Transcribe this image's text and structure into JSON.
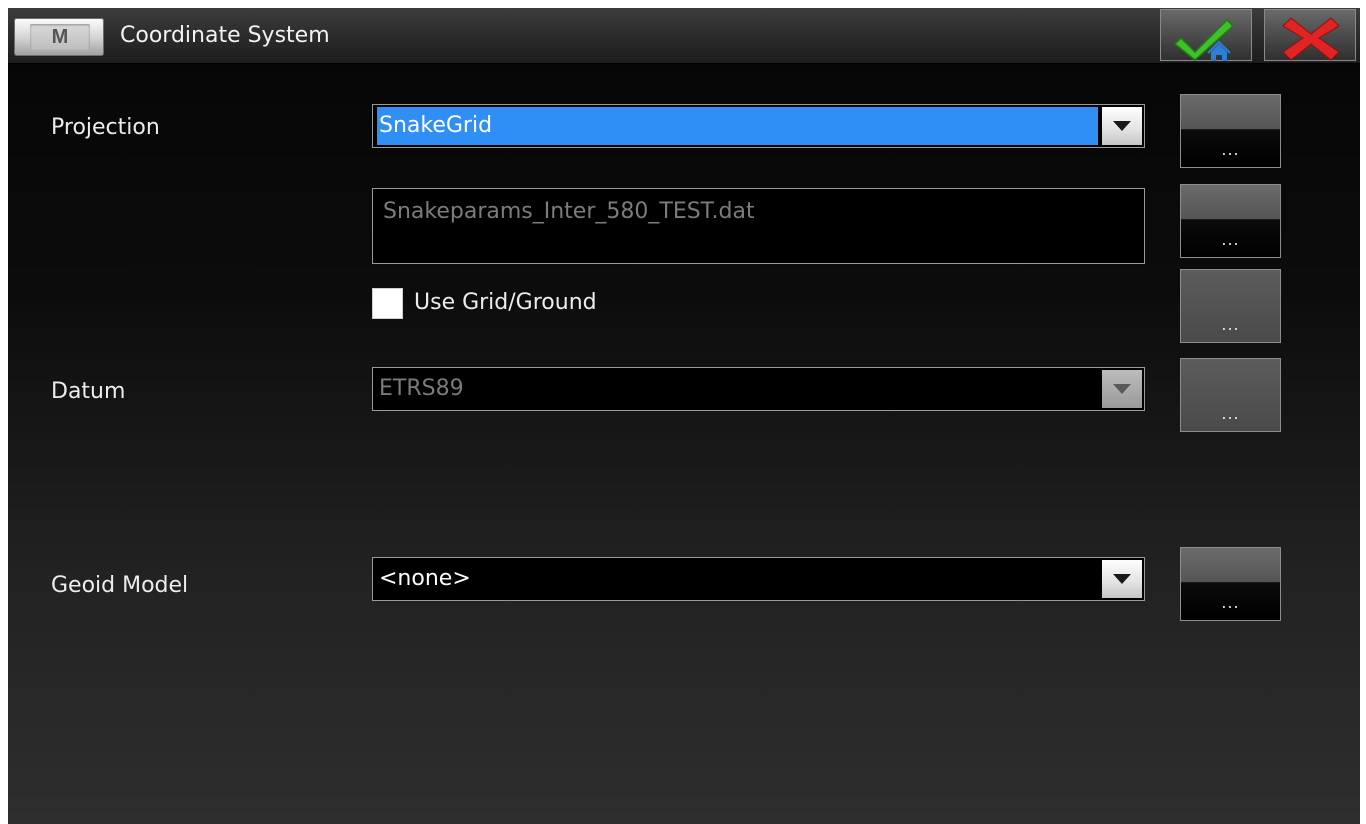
{
  "titlebar": {
    "menu_label": "M",
    "title": "Coordinate System",
    "accept_icon": "checkmark-home-icon",
    "cancel_icon": "red-x-icon"
  },
  "form": {
    "projection": {
      "label": "Projection",
      "value": "SnakeGrid",
      "more_label": "..."
    },
    "projection_file": {
      "value": "Snakeparams_Inter_580_TEST.dat",
      "more_label": "..."
    },
    "grid_ground": {
      "label": "Use Grid/Ground",
      "checked": false,
      "more_label": "..."
    },
    "datum": {
      "label": "Datum",
      "value": "ETRS89",
      "more_label": "..."
    },
    "geoid": {
      "label": "Geoid Model",
      "value": "<none>",
      "more_label": "..."
    }
  },
  "colors": {
    "selection_blue": "#2f8ff6",
    "check_green": "#3fbf2a",
    "cancel_red": "#e02424"
  }
}
